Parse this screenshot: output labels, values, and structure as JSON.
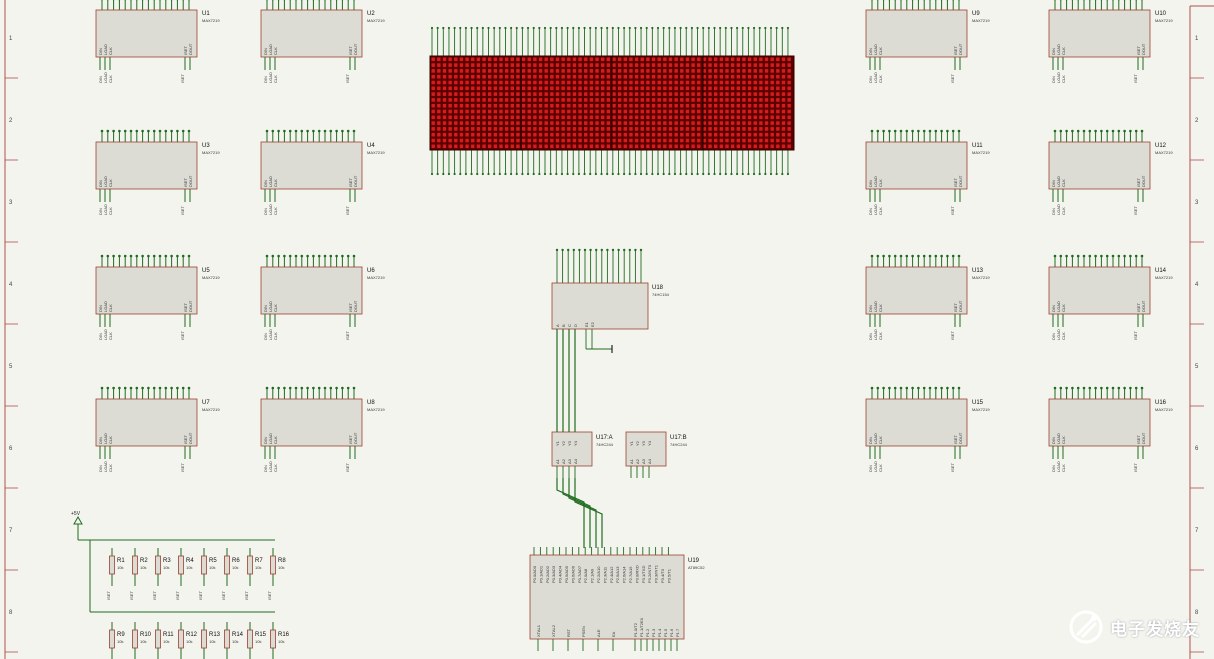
{
  "sheet": {
    "row_markers": [
      "1",
      "2",
      "3",
      "4",
      "5",
      "6",
      "7",
      "8"
    ],
    "colors": {
      "paper": "#f4f4ee",
      "wire": "#1f6b1f",
      "part_fill": "#dcdcd4",
      "part_stroke": "#9a4030",
      "matrix_bg": "#5a0000",
      "matrix_led": "#d81c1c"
    }
  },
  "max7219": {
    "type": "MAX7219",
    "parts": [
      {
        "ref": "U1"
      },
      {
        "ref": "U2"
      },
      {
        "ref": "U3"
      },
      {
        "ref": "U4"
      },
      {
        "ref": "U5"
      },
      {
        "ref": "U6"
      },
      {
        "ref": "U7"
      },
      {
        "ref": "U8"
      },
      {
        "ref": "U9"
      },
      {
        "ref": "U10"
      },
      {
        "ref": "U11"
      },
      {
        "ref": "U12"
      },
      {
        "ref": "U13"
      },
      {
        "ref": "U14"
      },
      {
        "ref": "U15"
      },
      {
        "ref": "U16"
      }
    ],
    "top_pins": [
      "A",
      "B",
      "C",
      "D",
      "E",
      "F",
      "G",
      "DP",
      "DIG0",
      "DIG1",
      "DIG2",
      "DIG3",
      "DIG4",
      "DIG5",
      "DIG6",
      "DIG7"
    ],
    "left_pins": [
      "DIN",
      "LOAD",
      "CLK"
    ],
    "right_pins": [
      "ISET",
      "DOUT"
    ]
  },
  "decoder": {
    "ref": "U18",
    "type": "74HC154",
    "in_pins": [
      "A",
      "B",
      "C",
      "D"
    ],
    "enable_pins": [
      "E1",
      "E2"
    ]
  },
  "buffers": [
    {
      "ref": "U17:A",
      "type": "74HC244",
      "pins": [
        "Y1",
        "Y2",
        "Y3",
        "Y4",
        "A1",
        "A2",
        "A3",
        "A4"
      ]
    },
    {
      "ref": "U17:B",
      "type": "74HC244",
      "pins": [
        "Y1",
        "Y2",
        "Y3",
        "Y4",
        "A1",
        "A2",
        "A3",
        "A4"
      ]
    }
  ],
  "mcu": {
    "ref": "U19",
    "type": "AT89C52",
    "pins": [
      "P0.0/AD0",
      "P0.1/AD1",
      "P0.2/AD2",
      "P0.3/AD3",
      "P0.4/AD4",
      "P0.5/AD5",
      "P0.6/AD6",
      "P0.7/AD7",
      "P2.0/A8",
      "P2.1/A9",
      "P2.2/A10",
      "P2.3/A11",
      "P2.4/A12",
      "P2.5/A13",
      "P2.6/A14",
      "P2.7/A15",
      "P3.0/RXD",
      "P3.1/TXD",
      "P3.2/INT0",
      "P3.3/INT1",
      "P3.4/T0",
      "P3.5/T1"
    ],
    "bottom_pins": [
      "XTAL1",
      "XTAL2",
      "RST",
      "PSEN",
      "ALE",
      "EA",
      "P1.0/T2",
      "P1.1/T2EX",
      "P1.2",
      "P1.3",
      "P1.4",
      "P1.5",
      "P1.6",
      "P1.7"
    ]
  },
  "power": {
    "label": "+5V"
  },
  "resistors": {
    "value": "10k",
    "row1": [
      {
        "ref": "R1"
      },
      {
        "ref": "R2"
      },
      {
        "ref": "R3"
      },
      {
        "ref": "R4"
      },
      {
        "ref": "R5"
      },
      {
        "ref": "R6"
      },
      {
        "ref": "R7"
      },
      {
        "ref": "R8"
      }
    ],
    "row2": [
      {
        "ref": "R9"
      },
      {
        "ref": "R10"
      },
      {
        "ref": "R11"
      },
      {
        "ref": "R12"
      },
      {
        "ref": "R13"
      },
      {
        "ref": "R14"
      },
      {
        "ref": "R15"
      },
      {
        "ref": "R16"
      }
    ]
  },
  "watermark": {
    "text": "电子发烧友",
    "mark": "elecfans-logo-icon"
  }
}
